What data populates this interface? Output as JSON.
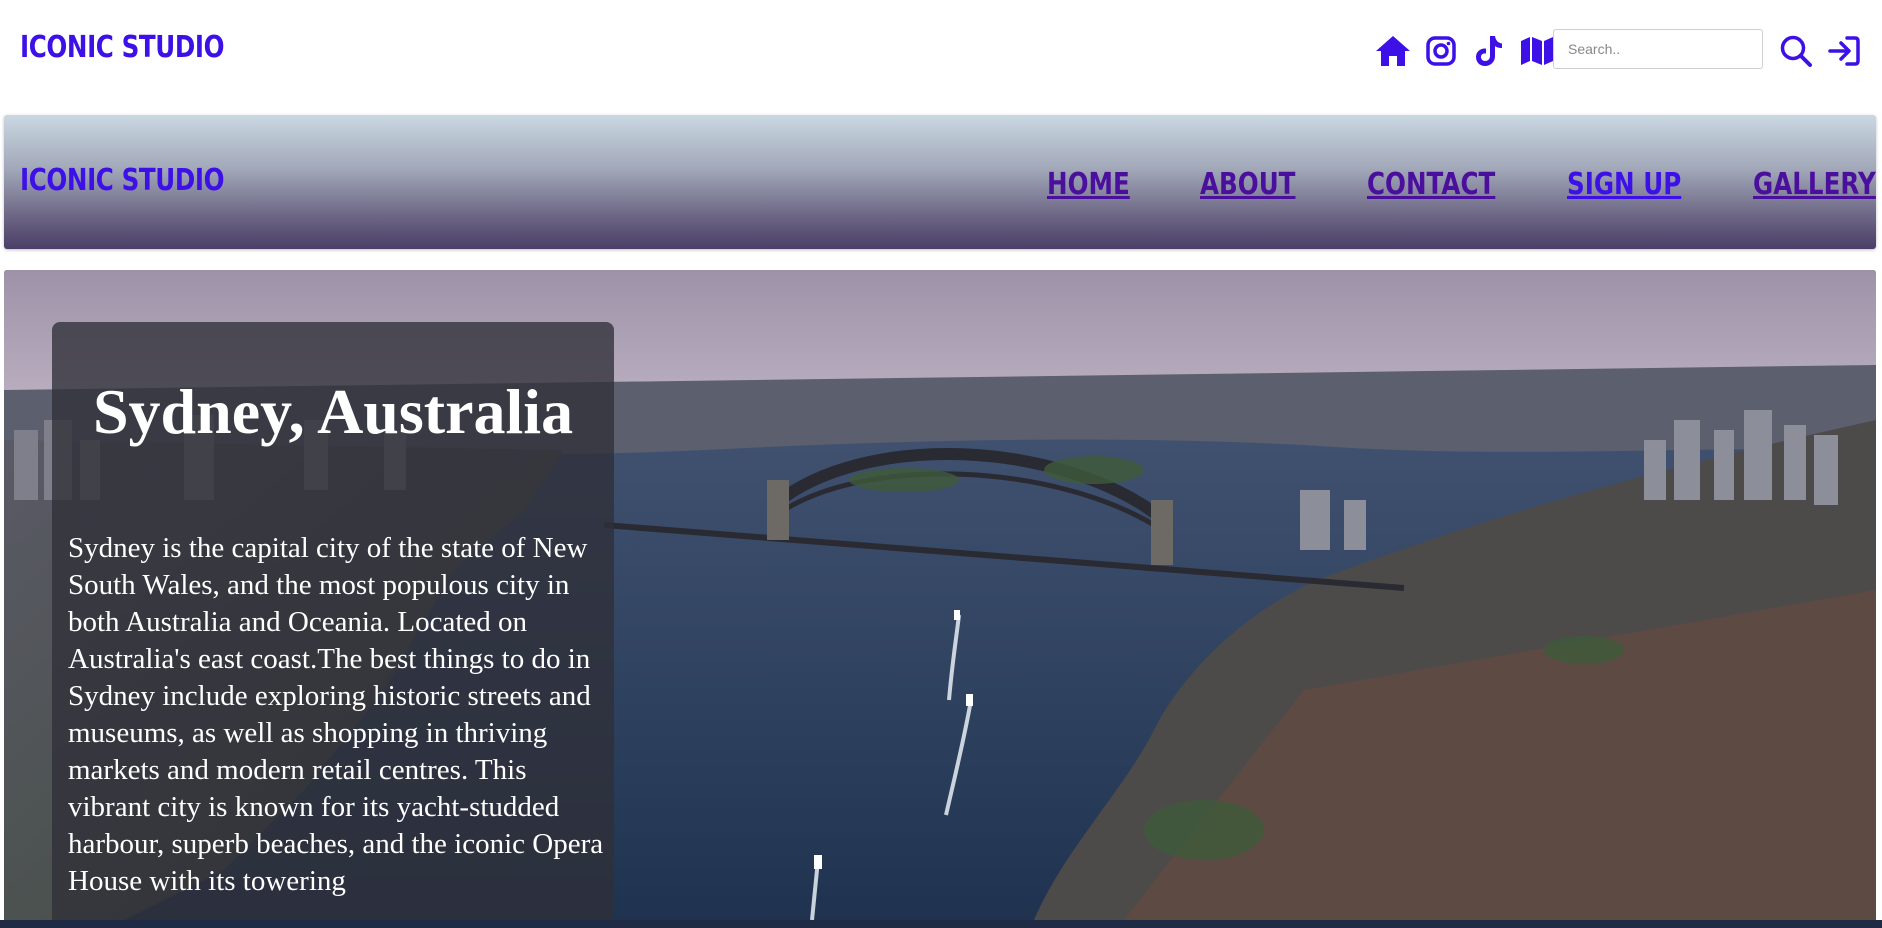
{
  "topbar": {
    "brand": "ICONIC STUDIO",
    "icons": [
      "home-icon",
      "instagram-icon",
      "tiktok-icon",
      "map-icon"
    ],
    "search": {
      "placeholder": "Search..",
      "value": ""
    },
    "search_icon": "search-icon",
    "login_icon": "sign-in-icon"
  },
  "navbar": {
    "brand": "ICONIC STUDIO",
    "links": [
      {
        "label": "HOME"
      },
      {
        "label": "ABOUT"
      },
      {
        "label": "CONTACT"
      },
      {
        "label": "SIGN UP"
      },
      {
        "label": "GALLERY"
      }
    ]
  },
  "hero": {
    "title": "Sydney, Australia",
    "text": "Sydney is the capital city of the state of New South Wales, and the most populous city in both Australia and Oceania. Located on Australia's east coast.The best things to do in Sydney include exploring historic streets and museums, as well as shopping in thriving markets and modern retail centres. This vibrant city is known for its yacht-studded harbour, superb beaches, and the iconic Opera House with its towering"
  },
  "colors": {
    "brand": "#3d10e8",
    "nav_link": "#4b0f9e",
    "nav_active": "#3d10e8"
  }
}
